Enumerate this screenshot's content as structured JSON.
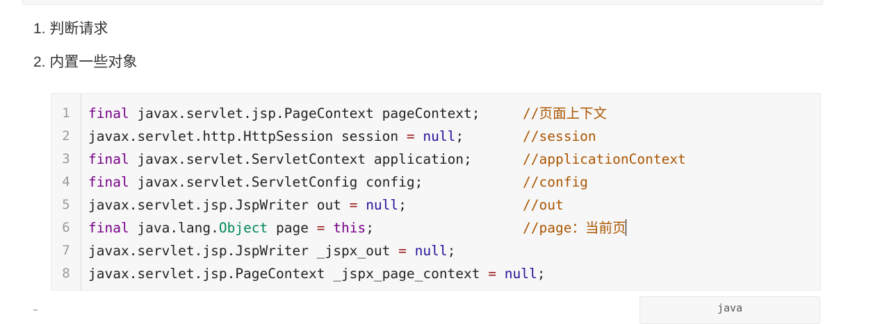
{
  "list": [
    {
      "text": "1. 判断请求"
    },
    {
      "text": "2. 内置一些对象"
    }
  ],
  "code_block": {
    "language": "java",
    "line_numbers": [
      "1",
      "2",
      "3",
      "4",
      "5",
      "6",
      "7",
      "8"
    ],
    "lines": [
      {
        "tokens": [
          {
            "t": "final",
            "c": "kw"
          },
          {
            "t": " javax.servlet.jsp.PageContext pageContext;"
          }
        ],
        "comment": "//页面上下文"
      },
      {
        "tokens": [
          {
            "t": "javax.servlet.http.HttpSession session "
          },
          {
            "t": "=",
            "c": "op"
          },
          {
            "t": " "
          },
          {
            "t": "null",
            "c": "atom"
          },
          {
            "t": ";"
          }
        ],
        "comment": "//session"
      },
      {
        "tokens": [
          {
            "t": "final",
            "c": "kw"
          },
          {
            "t": " javax.servlet.ServletContext application;"
          }
        ],
        "comment": "//applicationContext"
      },
      {
        "tokens": [
          {
            "t": "final",
            "c": "kw"
          },
          {
            "t": " javax.servlet.ServletConfig config;"
          }
        ],
        "comment": "//config"
      },
      {
        "tokens": [
          {
            "t": "javax.servlet.jsp.JspWriter out "
          },
          {
            "t": "=",
            "c": "op"
          },
          {
            "t": " "
          },
          {
            "t": "null",
            "c": "atom"
          },
          {
            "t": ";"
          }
        ],
        "comment": "//out"
      },
      {
        "tokens": [
          {
            "t": "final",
            "c": "kw"
          },
          {
            "t": " java.lang."
          },
          {
            "t": "Object",
            "c": "type"
          },
          {
            "t": " page "
          },
          {
            "t": "=",
            "c": "op"
          },
          {
            "t": " "
          },
          {
            "t": "this",
            "c": "kw"
          },
          {
            "t": ";"
          }
        ],
        "comment": "//page：当前页",
        "caret_after_comment": true
      },
      {
        "tokens": [
          {
            "t": "javax.servlet.jsp.JspWriter _jspx_out "
          },
          {
            "t": "=",
            "c": "op"
          },
          {
            "t": " "
          },
          {
            "t": "null",
            "c": "atom"
          },
          {
            "t": ";"
          }
        ],
        "comment": ""
      },
      {
        "tokens": [
          {
            "t": "javax.servlet.jsp.PageContext _jspx_page_context "
          },
          {
            "t": "=",
            "c": "op"
          },
          {
            "t": " "
          },
          {
            "t": "null",
            "c": "atom"
          },
          {
            "t": ";"
          }
        ],
        "comment": ""
      }
    ]
  },
  "colors": {
    "keyword": "#770088",
    "atom": "#221199",
    "comment": "#aa5500",
    "type": "#008855",
    "operator": "#981a1a"
  }
}
